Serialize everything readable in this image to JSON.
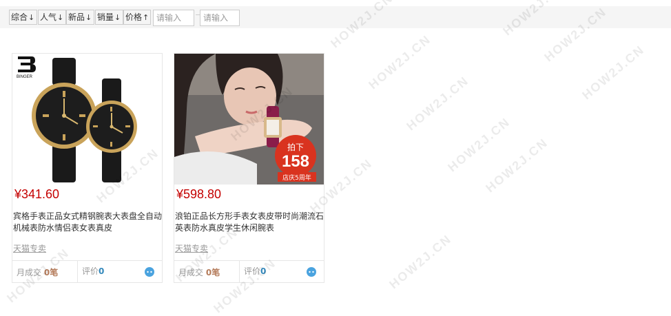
{
  "sort_bar": {
    "items": [
      {
        "label": "综合",
        "arrow": "↓"
      },
      {
        "label": "人气",
        "arrow": "↓"
      },
      {
        "label": "新品",
        "arrow": "↓"
      },
      {
        "label": "销量",
        "arrow": "↓"
      },
      {
        "label": "价格",
        "arrow": "↑"
      }
    ],
    "min_price_placeholder": "请输入",
    "max_price_placeholder": "请输入"
  },
  "products": [
    {
      "price": "¥341.60",
      "title": "宾格手表正品女式精钢腕表大表盘全自动机械表防水情侣表女表真皮",
      "shop": "天猫专卖",
      "monthly_sales_label": "月成交",
      "monthly_sales_value": "0笔",
      "reviews_label": "评价",
      "reviews_value": "0",
      "brand_logo_text": "BINGER"
    },
    {
      "price": "¥598.80",
      "title": "浪铂正品长方形手表女表皮带时尚潮流石英表防水真皮学生休闲腕表",
      "shop": "天猫专卖",
      "monthly_sales_label": "月成交",
      "monthly_sales_value": "0笔",
      "reviews_label": "评价",
      "reviews_value": "0",
      "badge_top": "拍下",
      "badge_price": "158",
      "badge_bottom": "店庆5周年"
    }
  ],
  "watermark": "HOW2J.CN",
  "colors": {
    "price": "#c40000",
    "sales": "#b57c5b",
    "reviews": "#3388bb"
  }
}
